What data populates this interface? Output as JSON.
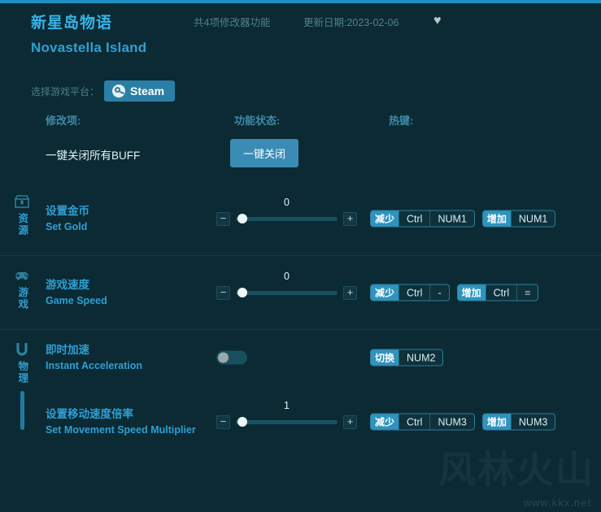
{
  "header": {
    "title_cn": "新星岛物语",
    "title_en": "Novastella Island",
    "feature_count": "共4项修改器功能",
    "update_date": "更新日期:2023-02-06",
    "favorite_icon": "♥"
  },
  "platform": {
    "label": "选择游戏平台：",
    "selected": "Steam"
  },
  "columns": {
    "item": "修改项:",
    "status": "功能状态:",
    "hotkey": "热键:"
  },
  "close_all": {
    "label": "一键关闭所有BUFF",
    "button": "一键关闭"
  },
  "sections": [
    {
      "category_cn": "资源",
      "icon": "chest-icon",
      "rows": [
        {
          "name_cn": "设置金币",
          "name_en": "Set Gold",
          "control": "slider",
          "value": "0",
          "minus": "−",
          "plus": "+",
          "hotkeys": [
            {
              "label": "减少",
              "keys": [
                "Ctrl",
                "NUM1"
              ]
            },
            {
              "label": "增加",
              "keys": [
                "NUM1"
              ]
            }
          ]
        }
      ]
    },
    {
      "category_cn": "游戏",
      "icon": "gamepad-icon",
      "rows": [
        {
          "name_cn": "游戏速度",
          "name_en": "Game Speed",
          "control": "slider",
          "value": "0",
          "minus": "−",
          "plus": "+",
          "hotkeys": [
            {
              "label": "减少",
              "keys": [
                "Ctrl",
                "-"
              ]
            },
            {
              "label": "增加",
              "keys": [
                "Ctrl",
                "="
              ]
            }
          ]
        }
      ]
    },
    {
      "category_cn": "物理",
      "icon": "magnet-icon",
      "rows": [
        {
          "name_cn": "即时加速",
          "name_en": "Instant Acceleration",
          "control": "toggle",
          "toggle_on": false,
          "hotkeys": [
            {
              "label": "切换",
              "keys": [
                "NUM2"
              ]
            }
          ]
        },
        {
          "name_cn": "设置移动速度倍率",
          "name_en": "Set Movement Speed Multiplier",
          "control": "slider",
          "value": "1",
          "minus": "−",
          "plus": "+",
          "hotkeys": [
            {
              "label": "减少",
              "keys": [
                "Ctrl",
                "NUM3"
              ]
            },
            {
              "label": "增加",
              "keys": [
                "NUM3"
              ]
            }
          ]
        }
      ]
    }
  ],
  "watermark": {
    "logo": "风林火山",
    "url": "www.kkx.net"
  },
  "colors": {
    "background": "#0b2a33",
    "accent": "#2f93bf",
    "title": "#35b4e8",
    "muted": "#51808e"
  }
}
